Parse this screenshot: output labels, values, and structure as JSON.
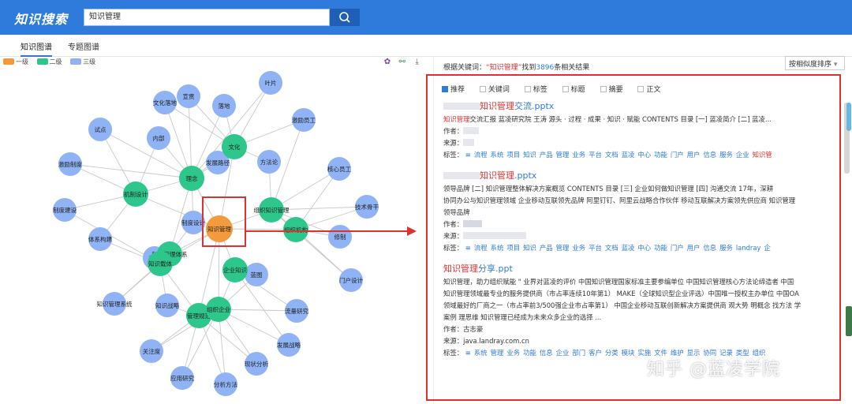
{
  "header": {
    "logo": "知识搜索",
    "search_value": "知识管理"
  },
  "tabs": [
    {
      "label": "知识图谱",
      "active": true
    },
    {
      "label": "专题图谱",
      "active": false
    }
  ],
  "legend": [
    {
      "label": "一级",
      "color": "#f39a3c"
    },
    {
      "label": "二级",
      "color": "#2ec78b"
    },
    {
      "label": "三级",
      "color": "#8fb3f5"
    }
  ],
  "toolbar_icons": [
    "palette-icon",
    "share-graph-icon",
    "download-icon"
  ],
  "graph": {
    "center": "知识管理",
    "level2": [
      "文化",
      "理念",
      "组织知识管理",
      "知识管理体系",
      "机制设计",
      "知识载体",
      "企业知识",
      "组织机构",
      "管理规范",
      "组织企业"
    ],
    "level3": [
      "叶片",
      "宣贯",
      "文化落地",
      "落地",
      "激励员工",
      "试点",
      "内部",
      "发展路径",
      "方法论",
      "核心员工",
      "激励制度",
      "制度设计",
      "技术骨干",
      "制度建设",
      "体系构建",
      "修制",
      "苏实",
      "知识管理系统",
      "知识战略",
      "门户设计",
      "蓝图",
      "流量研究",
      "关注度",
      "发展战略",
      "应用研究",
      "现状分析",
      "分析方法"
    ]
  },
  "results_header": {
    "prefix": "根据关键词：",
    "keyword": "“知识管理”",
    "found": "找到",
    "count": "3896",
    "suffix": "条相关结果"
  },
  "sort": {
    "selected": "按相似度排序"
  },
  "filters": [
    {
      "label": "推荐",
      "checked": true
    },
    {
      "label": "关键词",
      "checked": false
    },
    {
      "label": "标签",
      "checked": false
    },
    {
      "label": "标题",
      "checked": false
    },
    {
      "label": "摘要",
      "checked": false
    },
    {
      "label": "正文",
      "checked": false
    }
  ],
  "results": [
    {
      "title_hl": "知识管理",
      "title_rest": "交流.pptx",
      "snippet_hl": "知识管理",
      "snippet": "交流汇报 蓝凌研究院 王涛 源头 · 过程 · 成果 · 知识 · 赋能 CONTENTS 目录 [一] 蓝凌简介 [二] 蓝凌...",
      "author_label": "作者：",
      "source_label": "来源：",
      "tags_label": "标签：",
      "tags": [
        "流程",
        "系统",
        "项目",
        "知识",
        "产品",
        "管理",
        "业务",
        "平台",
        "文档",
        "蓝凌",
        "中心",
        "功能",
        "门户",
        "用户",
        "信息",
        "服务",
        "企业"
      ],
      "tag_hl": "知识管"
    },
    {
      "title_hl": "知识管理",
      "title_rest": ".pptx",
      "snippet_line1": "领导品牌 [二] 知识管理整体解决方案概览 CONTENTS 目录 [三] 企业如何做知识管理 [四] 沟通交流 17年，深耕",
      "snippet_line2": "协同办公与知识管理领域 企业移动互联领先品牌 阿里钉钉、阿里云战略合作伙伴 移动互联解决方案领先供应商 知识管理",
      "snippet_line3": "领导品牌",
      "author_label": "作者：",
      "source_label": "来源：",
      "tags_label": "标签：",
      "tags": [
        "流程",
        "系统",
        "项目",
        "知识",
        "产品",
        "管理",
        "业务",
        "平台",
        "文档",
        "蓝凌",
        "中心",
        "功能",
        "门户",
        "用户",
        "信息",
        "服务",
        "landray",
        "企"
      ]
    },
    {
      "title_hl": "知识管理",
      "title_rest": "分享.ppt",
      "line1": "知识管理，助力组织赋能 \" 业界对蓝凌的评价 中国知识管理国家标准主要参编单位 中国知识管理核心方法论缔造者 中国",
      "line2": "知识管理领域最专业的服务提供商（市占率连续10年第1） MAKE（全球知识型企业评选）中国唯一授权主办单位 中国OA",
      "line3": "领域最好的厂商之一（市占率前3/500强企业市占率第1） 中国企业移动互联创新解决方案提供商 观大势 明概念 找方法 学",
      "line4": "案例 理思维 知识管理已经成为未来众多企业的选择 ...",
      "author": "作者：古志豪",
      "source": "来源：java.landray.com.cn",
      "tags_label": "标签：",
      "tags": [
        "系统",
        "管理",
        "业务",
        "功能",
        "信息",
        "企业",
        "部门",
        "客户",
        "分类",
        "模块",
        "实施",
        "文件",
        "维护",
        "显示",
        "协同",
        "记录",
        "类型",
        "组织"
      ]
    }
  ],
  "watermark": "知乎 @蓝凌学院"
}
